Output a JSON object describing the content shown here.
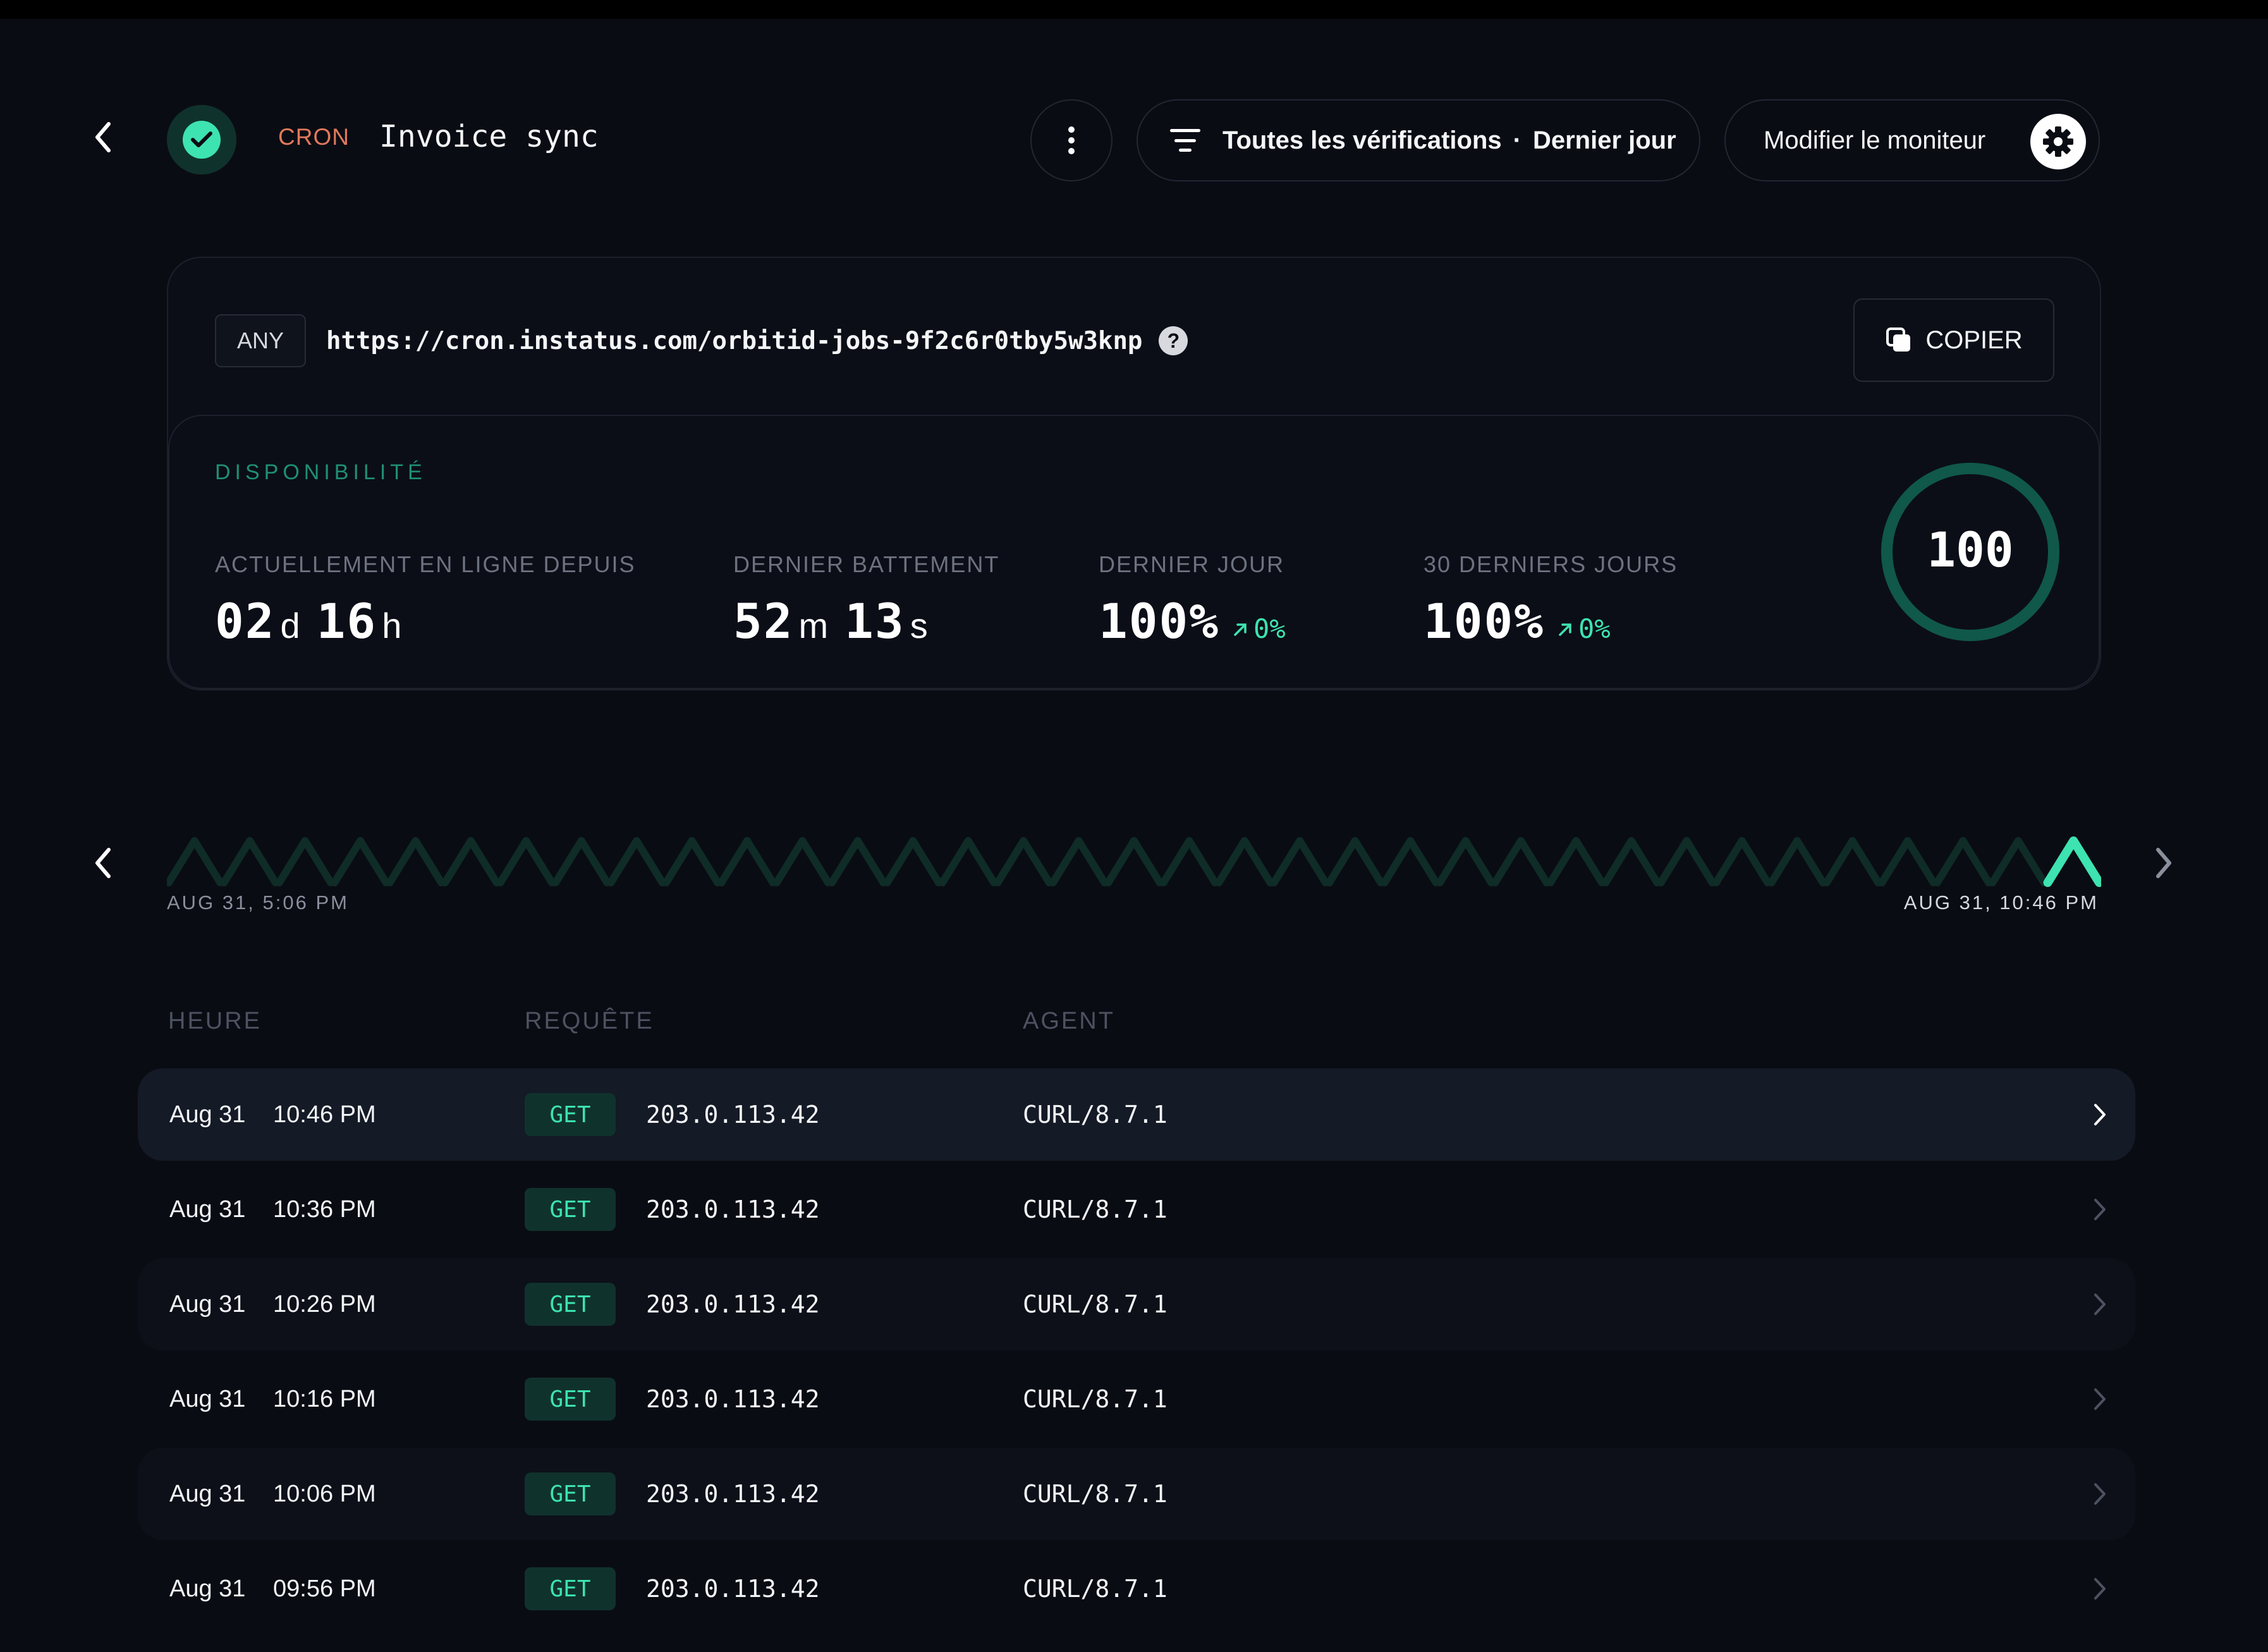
{
  "header": {
    "monitor_type": "CRON",
    "monitor_name": "Invoice sync",
    "filter_label": "Toutes les vérifications",
    "filter_separator": "·",
    "filter_period": "Dernier jour",
    "edit_label": "Modifier le moniteur",
    "status": "up",
    "icons": [
      "back-arrow-icon",
      "check-icon",
      "more-vertical-icon",
      "filter-icon",
      "gear-icon"
    ]
  },
  "endpoint": {
    "method_tag": "ANY",
    "url": "https://cron.instatus.com/orbitid-jobs-9f2c6r0tby5w3knp",
    "help_glyph": "?",
    "copy_label": "COPIER"
  },
  "availability": {
    "section_label": "DISPONIBILITÉ",
    "online_since": {
      "label": "ACTUELLEMENT EN LIGNE DEPUIS",
      "days": "02",
      "days_unit": "d",
      "hours": "16",
      "hours_unit": "h"
    },
    "last_beat": {
      "label": "DERNIER BATTEMENT",
      "minutes": "52",
      "minutes_unit": "m",
      "seconds": "13",
      "seconds_unit": "s"
    },
    "last_day": {
      "label": "DERNIER JOUR",
      "value": "100%",
      "delta": "0%"
    },
    "last_30_days": {
      "label": "30 DERNIERS JOURS",
      "value": "100%",
      "delta": "0%"
    },
    "score": "100",
    "accent_color": "#3de3b0",
    "ring_color": "#10584a"
  },
  "timeline": {
    "start_label": "AUG 31, 5:06 PM",
    "end_label": "AUG 31, 10:46 PM",
    "beat_count": 35,
    "highlighted_beat": "last"
  },
  "table": {
    "headers": {
      "time": "HEURE",
      "request": "REQUÊTE",
      "agent": "AGENT"
    },
    "rows": [
      {
        "date": "Aug 31",
        "time": "10:46 PM",
        "method": "GET",
        "ip": "203.0.113.42",
        "agent": "CURL/8.7.1",
        "selected": true
      },
      {
        "date": "Aug 31",
        "time": "10:36 PM",
        "method": "GET",
        "ip": "203.0.113.42",
        "agent": "CURL/8.7.1"
      },
      {
        "date": "Aug 31",
        "time": "10:26 PM",
        "method": "GET",
        "ip": "203.0.113.42",
        "agent": "CURL/8.7.1"
      },
      {
        "date": "Aug 31",
        "time": "10:16 PM",
        "method": "GET",
        "ip": "203.0.113.42",
        "agent": "CURL/8.7.1"
      },
      {
        "date": "Aug 31",
        "time": "10:06 PM",
        "method": "GET",
        "ip": "203.0.113.42",
        "agent": "CURL/8.7.1"
      },
      {
        "date": "Aug 31",
        "time": "09:56 PM",
        "method": "GET",
        "ip": "203.0.113.42",
        "agent": "CURL/8.7.1"
      }
    ]
  }
}
